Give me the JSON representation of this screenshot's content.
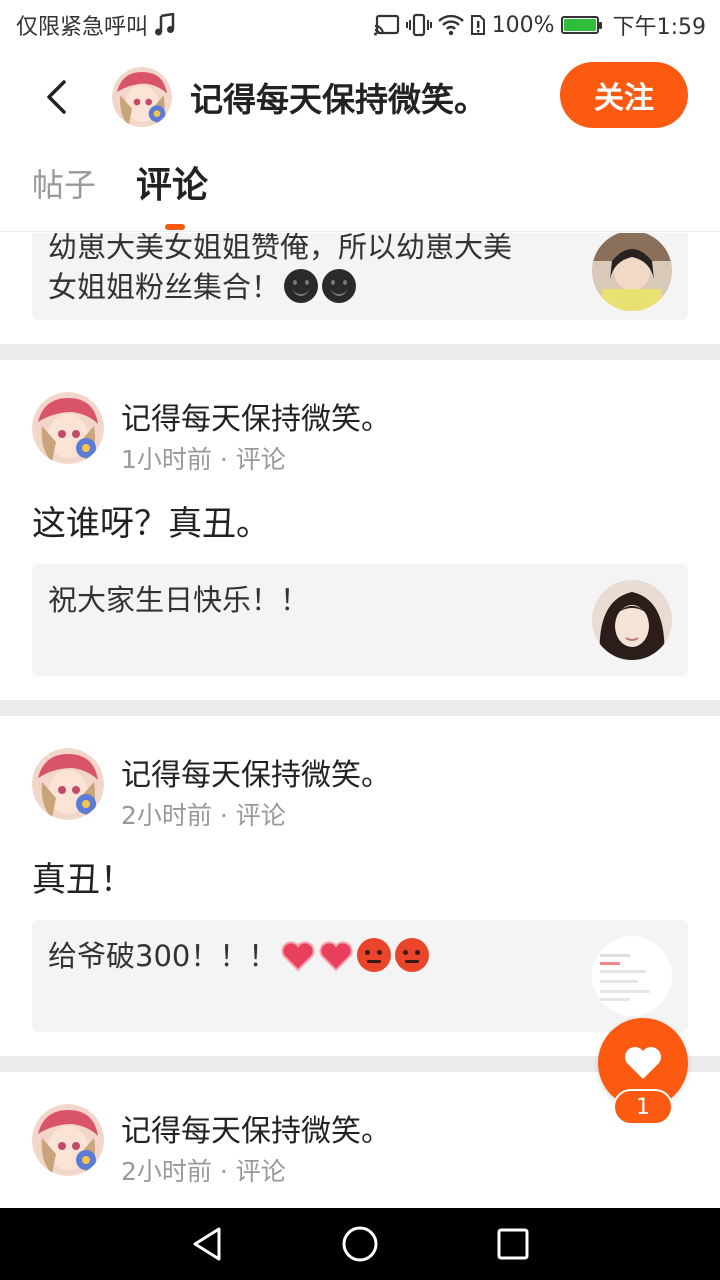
{
  "status_bar": {
    "left_text": "仅限紧急呼叫",
    "battery": "100%",
    "time": "下午1:59"
  },
  "header": {
    "title": "记得每天保持微笑。",
    "follow_label": "关注"
  },
  "tabs": [
    {
      "label": "帖子",
      "active": false
    },
    {
      "label": "评论",
      "active": true
    }
  ],
  "feed": {
    "top_quote": {
      "line1": "幼崽大美女姐姐赞俺，所以幼崽大美",
      "line2": "女姐姐粉丝集合！"
    },
    "posts": [
      {
        "author": "记得每天保持微笑。",
        "meta": "1小时前 · 评论",
        "text": "这谁呀？真丑。",
        "quote": "祝大家生日快乐！！"
      },
      {
        "author": "记得每天保持微笑。",
        "meta": "2小时前 · 评论",
        "text": "真丑！",
        "quote": "给爷破300！！！"
      },
      {
        "author": "记得每天保持微笑。",
        "meta": "2小时前 · 评论"
      }
    ]
  },
  "like": {
    "count": "1"
  },
  "colors": {
    "accent": "#fb5a10",
    "separator": "#ececec",
    "quote_bg": "#f4f4f4"
  }
}
